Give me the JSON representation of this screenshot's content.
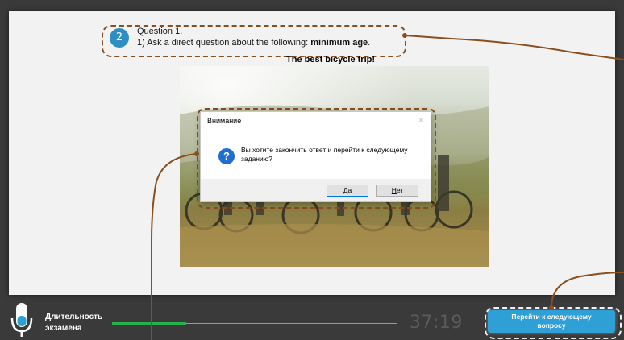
{
  "question": {
    "number": "2",
    "title": "Question 1.",
    "prompt_prefix": "1) Ask a direct question about the following:",
    "prompt_bold": "minimum age",
    "prompt_suffix": "."
  },
  "picture_title": "The best bicycle trip!",
  "dialog": {
    "title": "Внимание",
    "close": "×",
    "message": "Вы хотите закончить ответ и перейти к следующему заданию?",
    "icon": "question-icon",
    "yes_underline": "Д",
    "yes_rest": "а",
    "no_underline": "Н",
    "no_rest": "ет"
  },
  "footer": {
    "duration_label_line1": "Длительность",
    "duration_label_line2": "экзамена",
    "progress_fraction": 0.26,
    "timer": "37:19",
    "next_button": "Перейти к следующему вопросу"
  },
  "colors": {
    "accent": "#2fa0d6",
    "badge": "#2d8ec4",
    "progress": "#25b24a",
    "callout": "#8a4f1e"
  }
}
